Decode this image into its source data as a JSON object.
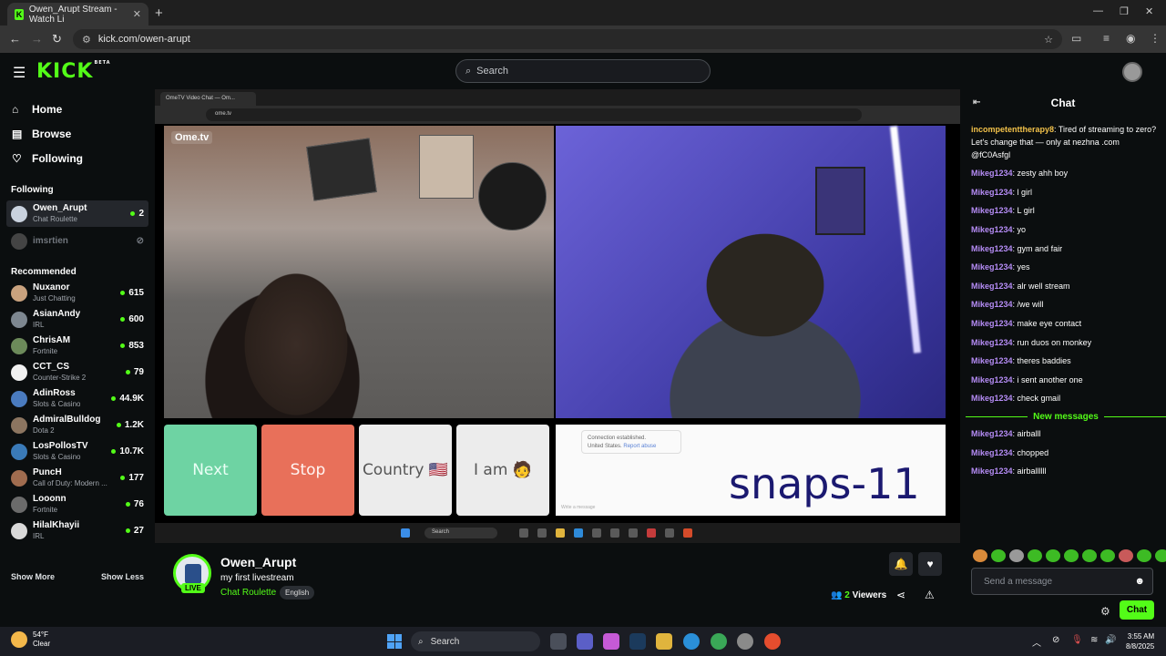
{
  "browser": {
    "tab_title": "Owen_Arupt Stream - Watch Li",
    "favicon_letter": "K",
    "url": "kick.com/owen-arupt"
  },
  "header": {
    "logo": "KICK",
    "logo_badge": "BETA",
    "search_placeholder": "Search"
  },
  "sidebar": {
    "nav": [
      {
        "label": "Home",
        "icon": "home-icon"
      },
      {
        "label": "Browse",
        "icon": "browse-icon"
      },
      {
        "label": "Following",
        "icon": "heart-icon"
      }
    ],
    "following_title": "Following",
    "following": [
      {
        "name": "Owen_Arupt",
        "category": "Chat Roulette",
        "viewers": "2",
        "live": true
      },
      {
        "name": "imsrtien",
        "category": "",
        "viewers": "",
        "live": false
      }
    ],
    "recommended_title": "Recommended",
    "recommended": [
      {
        "name": "Nuxanor",
        "category": "Just Chatting",
        "viewers": "615"
      },
      {
        "name": "AsianAndy",
        "category": "IRL",
        "viewers": "600"
      },
      {
        "name": "ChrisAM",
        "category": "Fortnite",
        "viewers": "853"
      },
      {
        "name": "CCT_CS",
        "category": "Counter-Strike 2",
        "viewers": "79"
      },
      {
        "name": "AdinRoss",
        "category": "Slots & Casino",
        "viewers": "44.9K"
      },
      {
        "name": "AdmiralBulldog",
        "category": "Dota 2",
        "viewers": "1.2K"
      },
      {
        "name": "LosPollosTV",
        "category": "Slots & Casino",
        "viewers": "10.7K"
      },
      {
        "name": "PuncH",
        "category": "Call of Duty: Modern ...",
        "viewers": "177"
      },
      {
        "name": "Looonn",
        "category": "Fortnite",
        "viewers": "76"
      },
      {
        "name": "HilalKhayii",
        "category": "IRL",
        "viewers": "27"
      }
    ],
    "show_more": "Show More",
    "show_less": "Show Less"
  },
  "video": {
    "inner_tab": "OmeTV Video Chat — Om...",
    "inner_url": "ome.tv",
    "brand": "Ome.tv",
    "buttons": {
      "next": "Next",
      "stop": "Stop",
      "country": "Country 🇺🇸",
      "iam": "I am 🧑"
    },
    "connection": "Connection established.",
    "country_line": "United States.",
    "report": "Report abuse",
    "overlay_text": "snaps-11",
    "type_placeholder": "Write a message",
    "inner_search": "Search"
  },
  "stream_info": {
    "name": "Owen_Arupt",
    "title": "my first livestream",
    "category": "Chat Roulette",
    "language": "English",
    "live_badge": "LIVE",
    "viewer_count": "2",
    "viewer_label": "Viewers"
  },
  "chat": {
    "title": "Chat",
    "messages": [
      {
        "user": "incompetenttherapy8",
        "text": "Tired of streaming to zero? Let's change that — only at nezhna .com @fC0Asfgl",
        "color": "#f3c24a"
      },
      {
        "user": "Mikeg1234",
        "text": "zesty ahh boy",
        "color": "#b58cf5"
      },
      {
        "user": "Mikeg1234",
        "text": "l girl",
        "color": "#b58cf5"
      },
      {
        "user": "Mikeg1234",
        "text": "L girl",
        "color": "#b58cf5"
      },
      {
        "user": "Mikeg1234",
        "text": "yo",
        "color": "#b58cf5"
      },
      {
        "user": "Mikeg1234",
        "text": "gym and fair",
        "color": "#b58cf5"
      },
      {
        "user": "Mikeg1234",
        "text": "yes",
        "color": "#b58cf5"
      },
      {
        "user": "Mikeg1234",
        "text": "alr well stream",
        "color": "#b58cf5"
      },
      {
        "user": "Mikeg1234",
        "text": "/we will",
        "color": "#b58cf5"
      },
      {
        "user": "Mikeg1234",
        "text": "make eye contact",
        "color": "#b58cf5"
      },
      {
        "user": "Mikeg1234",
        "text": "run duos on monkey",
        "color": "#b58cf5"
      },
      {
        "user": "Mikeg1234",
        "text": "theres baddies",
        "color": "#b58cf5"
      },
      {
        "user": "Mikeg1234",
        "text": "i sent another one",
        "color": "#b58cf5"
      },
      {
        "user": "Mikeg1234",
        "text": "check gmail",
        "color": "#b58cf5"
      }
    ],
    "new_messages_label": "New messages",
    "new_messages": [
      {
        "user": "Mikeg1234",
        "text": "airballl",
        "color": "#b58cf5"
      },
      {
        "user": "Mikeg1234",
        "text": "chopped",
        "color": "#b58cf5"
      },
      {
        "user": "Mikeg1234",
        "text": "airballllll",
        "color": "#b58cf5"
      }
    ],
    "input_placeholder": "Send a message",
    "send_label": "Chat"
  },
  "taskbar": {
    "temp": "54°F",
    "condition": "Clear",
    "search": "Search",
    "time": "3:55 AM",
    "date": "8/8/2025"
  },
  "colors": {
    "accent": "#53fc18",
    "bg": "#0b0e0f"
  }
}
